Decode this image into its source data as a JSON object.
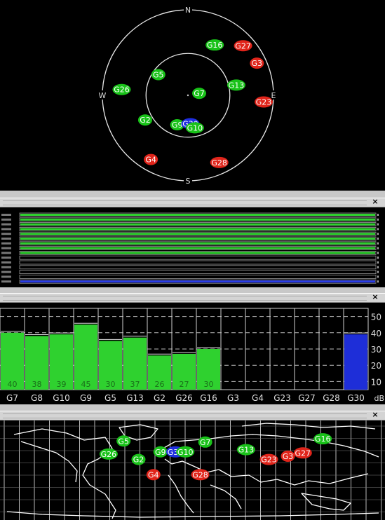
{
  "skyplot": {
    "directions": {
      "north": "N",
      "south": "S",
      "west": "W",
      "east": "E"
    },
    "satellites": [
      {
        "id": "G16",
        "az": 28,
        "el": 30,
        "color": "#19c219"
      },
      {
        "id": "G27",
        "az": 48,
        "el": 12,
        "color": "#e0241a"
      },
      {
        "id": "G3",
        "az": 65,
        "el": 10,
        "color": "#e0241a"
      },
      {
        "id": "G13",
        "az": 78,
        "el": 38,
        "color": "#19c219"
      },
      {
        "id": "G23",
        "az": 95,
        "el": 10,
        "color": "#e0241a"
      },
      {
        "id": "G7",
        "az": 80,
        "el": 78,
        "color": "#19c219"
      },
      {
        "id": "G5",
        "az": 305,
        "el": 52,
        "color": "#19c219"
      },
      {
        "id": "G26",
        "az": 275,
        "el": 20,
        "color": "#19c219"
      },
      {
        "id": "G2",
        "az": 240,
        "el": 38,
        "color": "#19c219"
      },
      {
        "id": "G9",
        "az": 200,
        "el": 57,
        "color": "#19c219"
      },
      {
        "id": "G30",
        "az": 175,
        "el": 60,
        "color": "#1e2ee0"
      },
      {
        "id": "G10",
        "az": 168,
        "el": 55,
        "color": "#19c219"
      },
      {
        "id": "G4",
        "az": 210,
        "el": 12,
        "color": "#e0241a"
      },
      {
        "id": "G28",
        "az": 155,
        "el": 12,
        "color": "#e0241a"
      }
    ]
  },
  "windows": [
    {
      "close": "×"
    },
    {
      "close": "×"
    },
    {
      "close": "×"
    }
  ],
  "bars_panel": {
    "rows": [
      {
        "color": "#2fcf2f",
        "level": 1.0
      },
      {
        "color": "#2fcf2f",
        "level": 1.0
      },
      {
        "color": "#2fcf2f",
        "level": 1.0
      },
      {
        "color": "#2fcf2f",
        "level": 1.0
      },
      {
        "color": "#2fcf2f",
        "level": 1.0
      },
      {
        "color": "#2fcf2f",
        "level": 1.0
      },
      {
        "color": "#2fcf2f",
        "level": 1.0
      },
      {
        "color": "#2fcf2f",
        "level": 1.0
      },
      {
        "color": "#2fcf2f",
        "level": 1.0
      },
      {
        "color": "#000000",
        "level": 0
      },
      {
        "color": "#000000",
        "level": 0
      },
      {
        "color": "#000000",
        "level": 0
      },
      {
        "color": "#000000",
        "level": 0
      },
      {
        "color": "#000000",
        "level": 0
      },
      {
        "color": "#2a3ce8",
        "level": 1.0
      }
    ]
  },
  "chart_data": {
    "type": "bar",
    "categories": [
      "G7",
      "G8",
      "G10",
      "G9",
      "G5",
      "G13",
      "G2",
      "G26",
      "G16",
      "G3",
      "G4",
      "G23",
      "G27",
      "G28",
      "G30"
    ],
    "values": [
      40,
      38,
      39,
      45,
      35,
      37,
      26,
      27,
      30,
      0,
      0,
      0,
      0,
      0,
      39
    ],
    "data_labels": [
      "40",
      "38",
      "39",
      "45",
      "30",
      "37",
      "26",
      "27",
      "30",
      "",
      "",
      "",
      "",
      "",
      ""
    ],
    "colors": [
      "#2fd12f",
      "#2fd12f",
      "#2fd12f",
      "#2fd12f",
      "#2fd12f",
      "#2fd12f",
      "#2fd12f",
      "#2fd12f",
      "#2fd12f",
      "",
      "",
      "",
      "",
      "",
      "#1e2ed8"
    ],
    "yticks": [
      "10",
      "20",
      "30",
      "40",
      "50"
    ],
    "ylim": [
      5,
      55
    ],
    "yunit": "dB",
    "grid": true
  },
  "world_map": {
    "satellites": [
      {
        "id": "G5",
        "lon": -40,
        "lat": 25,
        "color": "#19c219"
      },
      {
        "id": "G26",
        "lon": -55,
        "lat": 13,
        "color": "#19c219"
      },
      {
        "id": "G2",
        "lon": -25,
        "lat": 8,
        "color": "#19c219"
      },
      {
        "id": "G9",
        "lon": -3,
        "lat": 15,
        "color": "#19c219"
      },
      {
        "id": "G30",
        "lon": 12,
        "lat": 15,
        "color": "#1e2ee0"
      },
      {
        "id": "G10",
        "lon": 22,
        "lat": 15,
        "color": "#19c219"
      },
      {
        "id": "G7",
        "lon": 42,
        "lat": 24,
        "color": "#19c219"
      },
      {
        "id": "G4",
        "lon": -10,
        "lat": -6,
        "color": "#e0241a"
      },
      {
        "id": "G28",
        "lon": 37,
        "lat": -6,
        "color": "#e0241a"
      },
      {
        "id": "G13",
        "lon": 83,
        "lat": 17,
        "color": "#19c219"
      },
      {
        "id": "G23",
        "lon": 106,
        "lat": 8,
        "color": "#e0241a"
      },
      {
        "id": "G3",
        "lon": 125,
        "lat": 11,
        "color": "#e0241a"
      },
      {
        "id": "G27",
        "lon": 140,
        "lat": 14,
        "color": "#e0241a"
      },
      {
        "id": "G16",
        "lon": 160,
        "lat": 27,
        "color": "#19c219"
      }
    ]
  }
}
